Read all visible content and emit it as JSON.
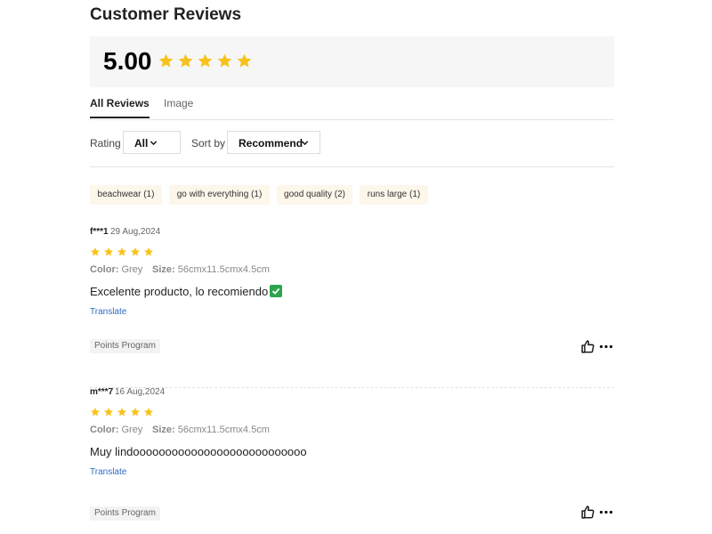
{
  "page": {
    "title": "Customer Reviews"
  },
  "summary": {
    "score": "5.00",
    "stars": 5
  },
  "tabs": [
    {
      "label": "All Reviews",
      "active": true
    },
    {
      "label": "Image",
      "active": false
    }
  ],
  "filters": {
    "rating_label": "Rating",
    "rating_value": "All",
    "sort_label": "Sort by",
    "sort_value": "Recommend"
  },
  "tags": [
    {
      "label": "beachwear (1)"
    },
    {
      "label": "go with everything (1)"
    },
    {
      "label": "good quality (2)"
    },
    {
      "label": "runs large (1)"
    }
  ],
  "reviews": [
    {
      "user": "f***1",
      "date": "29 Aug,2024",
      "stars": 5,
      "color_label": "Color:",
      "color_value": "Grey",
      "size_label": "Size:",
      "size_value": "56cmx11.5cmx4.5cm",
      "text": "Excelente producto, lo recomiendo",
      "translate": "Translate",
      "badge": "Points Program"
    },
    {
      "user": "m***7",
      "date": "16 Aug,2024",
      "stars": 5,
      "color_label": "Color:",
      "color_value": "Grey",
      "size_label": "Size:",
      "size_value": "56cmx11.5cmx4.5cm",
      "text": "Muy lindooooooooooooooooooooooooooo",
      "translate": "Translate",
      "badge": "Points Program"
    }
  ],
  "colors": {
    "star": "#f7c21b",
    "tag_bg": "#fdf6ea",
    "link": "#2f6bbf",
    "summary_bg": "#f6f6f6"
  },
  "icons": {
    "star": "star-icon",
    "chevron": "chevron-down-icon",
    "like": "thumbs-up-icon",
    "more": "more-icon",
    "check": "check-emoji-icon"
  }
}
